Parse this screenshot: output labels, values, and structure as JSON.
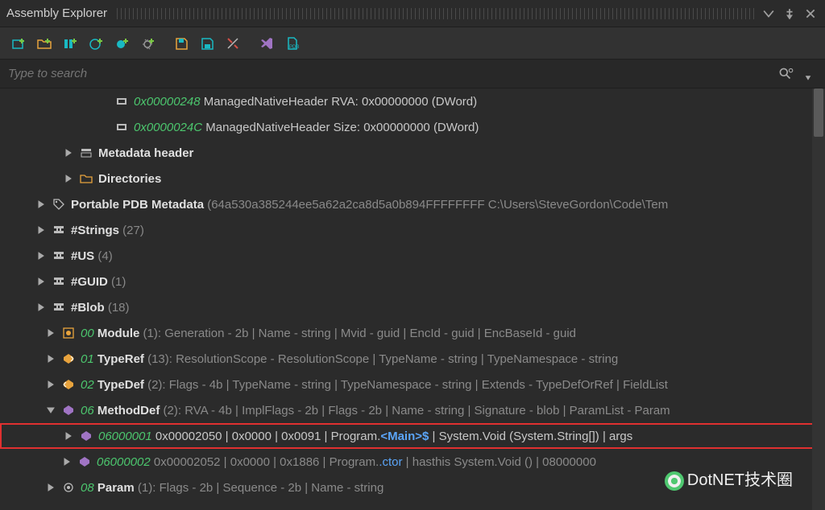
{
  "panel": {
    "title": "Assembly Explorer"
  },
  "search": {
    "placeholder": "Type to search"
  },
  "rows": [
    {
      "indent": 120,
      "kind": "leaf",
      "icon": "field",
      "address": "0x00000248",
      "rest": " ManagedNativeHeader RVA: 0x00000000 (DWord)"
    },
    {
      "indent": 120,
      "kind": "leaf",
      "icon": "field",
      "address": "0x0000024C",
      "rest": " ManagedNativeHeader Size: 0x00000000 (DWord)"
    },
    {
      "indent": 76,
      "kind": "node",
      "icon": "header",
      "name": "Metadata header"
    },
    {
      "indent": 76,
      "kind": "node",
      "icon": "folder",
      "name": "Directories"
    },
    {
      "indent": 42,
      "kind": "node",
      "icon": "tag",
      "name": "Portable PDB Metadata",
      "dim": " (64a530a385244ee5a62a2ca8d5a0b894FFFFFFFF C:\\Users\\SteveGordon\\Code\\Tem"
    },
    {
      "indent": 42,
      "kind": "node",
      "icon": "stream",
      "name": "#Strings",
      "count": " (27)"
    },
    {
      "indent": 42,
      "kind": "node",
      "icon": "stream",
      "name": "#US",
      "count": " (4)"
    },
    {
      "indent": 42,
      "kind": "node",
      "icon": "stream",
      "name": "#GUID",
      "count": " (1)"
    },
    {
      "indent": 42,
      "kind": "node",
      "icon": "stream",
      "name": "#Blob",
      "count": " (18)"
    },
    {
      "indent": 54,
      "kind": "node",
      "icon": "module",
      "idx": "00",
      "name": " Module",
      "dim": " (1): Generation - 2b | Name - string | Mvid - guid | EncId - guid | EncBaseId - guid"
    },
    {
      "indent": 54,
      "kind": "node",
      "icon": "typeref",
      "idx": "01",
      "name": " TypeRef",
      "dim": " (13): ResolutionScope - ResolutionScope | TypeName - string | TypeNamespace - string"
    },
    {
      "indent": 54,
      "kind": "node",
      "icon": "typedef",
      "idx": "02",
      "name": " TypeDef",
      "dim": " (2): Flags - 4b | TypeName - string | TypeNamespace - string | Extends - TypeDefOrRef | FieldList"
    },
    {
      "indent": 54,
      "kind": "node",
      "expanded": true,
      "icon": "method",
      "idx": "06",
      "name": " MethodDef",
      "dim": " (2): RVA - 4b | ImplFlags - 2b | Flags - 2b | Name - string | Signature - blob | ParamList - Param"
    },
    {
      "indent": 74,
      "kind": "node",
      "highlighted": true,
      "icon": "method",
      "parts": [
        {
          "cls": "idx",
          "t": "06000001"
        },
        {
          "cls": "txt",
          "t": " 0x00002050 | 0x0000 | 0x0091 | Program."
        },
        {
          "cls": "mref",
          "t": "<Main>$"
        },
        {
          "cls": "txt",
          "t": " | System.Void (System.String[]) | args"
        }
      ]
    },
    {
      "indent": 74,
      "kind": "node",
      "icon": "method",
      "parts": [
        {
          "cls": "idx",
          "t": "06000002"
        },
        {
          "cls": "dim",
          "t": " 0x00002052 | 0x0000 | 0x1886 | Program."
        },
        {
          "cls": "ctor",
          "t": ".ctor"
        },
        {
          "cls": "dim",
          "t": " | hasthis System.Void () | 08000000"
        }
      ]
    },
    {
      "indent": 54,
      "kind": "node",
      "icon": "param",
      "idx": "08",
      "name": " Param",
      "dim": " (1): Flags - 2b | Sequence - 2b | Name - string"
    }
  ],
  "watermark": "DotNET技术圈"
}
